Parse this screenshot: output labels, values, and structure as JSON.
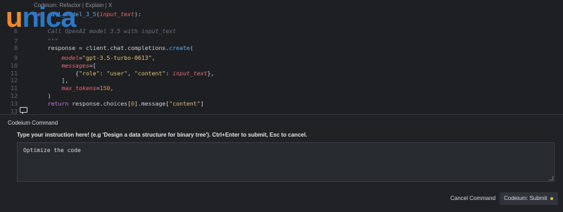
{
  "brand": {
    "logo_u": "u",
    "logo_rest": "nica"
  },
  "editor": {
    "code_lens": "Codeium: Refactor | Explain | X",
    "lines": [
      {
        "n": "",
        "parts": [
          {
            "t": "def ",
            "c": "kw"
          },
          {
            "t": "call_model_3_5",
            "c": "fn"
          },
          {
            "t": "(",
            "c": ""
          },
          {
            "t": "input_text",
            "c": "prm"
          },
          {
            "t": "):",
            "c": ""
          }
        ]
      },
      {
        "n": "5",
        "parts": []
      },
      {
        "n": "6",
        "parts": [
          {
            "t": "    Call OpenAI model 3.5 with input_text",
            "c": "cmt"
          }
        ]
      },
      {
        "n": "7",
        "parts": [
          {
            "t": "    \"\"\"",
            "c": "cmt"
          }
        ]
      },
      {
        "n": "8",
        "parts": [
          {
            "t": "    response = client.",
            "c": ""
          },
          {
            "t": "chat",
            "c": ""
          },
          {
            "t": ".",
            "c": ""
          },
          {
            "t": "completions",
            "c": ""
          },
          {
            "t": ".",
            "c": ""
          },
          {
            "t": "create",
            "c": "fn"
          },
          {
            "t": "(",
            "c": ""
          }
        ]
      },
      {
        "n": "9",
        "parts": [
          {
            "t": "        ",
            "c": ""
          },
          {
            "t": "model",
            "c": "prm"
          },
          {
            "t": "=",
            "c": ""
          },
          {
            "t": "\"gpt-3.5-turbo-0613\"",
            "c": "str"
          },
          {
            "t": ",",
            "c": ""
          }
        ]
      },
      {
        "n": "10",
        "parts": [
          {
            "t": "        ",
            "c": ""
          },
          {
            "t": "messages",
            "c": "prm"
          },
          {
            "t": "=[",
            "c": ""
          }
        ]
      },
      {
        "n": "11",
        "parts": [
          {
            "t": "            {",
            "c": ""
          },
          {
            "t": "\"role\"",
            "c": "str"
          },
          {
            "t": ": ",
            "c": ""
          },
          {
            "t": "\"user\"",
            "c": "str"
          },
          {
            "t": ", ",
            "c": ""
          },
          {
            "t": "\"content\"",
            "c": "str"
          },
          {
            "t": ": ",
            "c": ""
          },
          {
            "t": "input_text",
            "c": "prm"
          },
          {
            "t": "},",
            "c": ""
          }
        ]
      },
      {
        "n": "12",
        "parts": [
          {
            "t": "        ],",
            "c": ""
          }
        ]
      },
      {
        "n": "11",
        "parts": [
          {
            "t": "        ",
            "c": ""
          },
          {
            "t": "max_tokens",
            "c": "prm"
          },
          {
            "t": "=",
            "c": ""
          },
          {
            "t": "150",
            "c": "num"
          },
          {
            "t": ",",
            "c": ""
          }
        ]
      },
      {
        "n": "12",
        "parts": [
          {
            "t": "    )",
            "c": ""
          }
        ]
      },
      {
        "n": "13",
        "parts": [
          {
            "t": "    ",
            "c": ""
          },
          {
            "t": "return",
            "c": "kw"
          },
          {
            "t": " response.choices[",
            "c": ""
          },
          {
            "t": "0",
            "c": "num"
          },
          {
            "t": "].message[",
            "c": ""
          },
          {
            "t": "\"content\"",
            "c": "str"
          },
          {
            "t": "]",
            "c": ""
          }
        ]
      },
      {
        "n": "13",
        "parts": []
      }
    ]
  },
  "panel": {
    "title": "Codeium Command",
    "instruction": "Type your instruction here! (e.g 'Design a data structure for binary tree'). Ctrl+Enter to submit, Esc to cancel.",
    "input_value": "Optimize the code",
    "cancel_label": "Cancel Command",
    "submit_label": "Codeium: Submit"
  }
}
